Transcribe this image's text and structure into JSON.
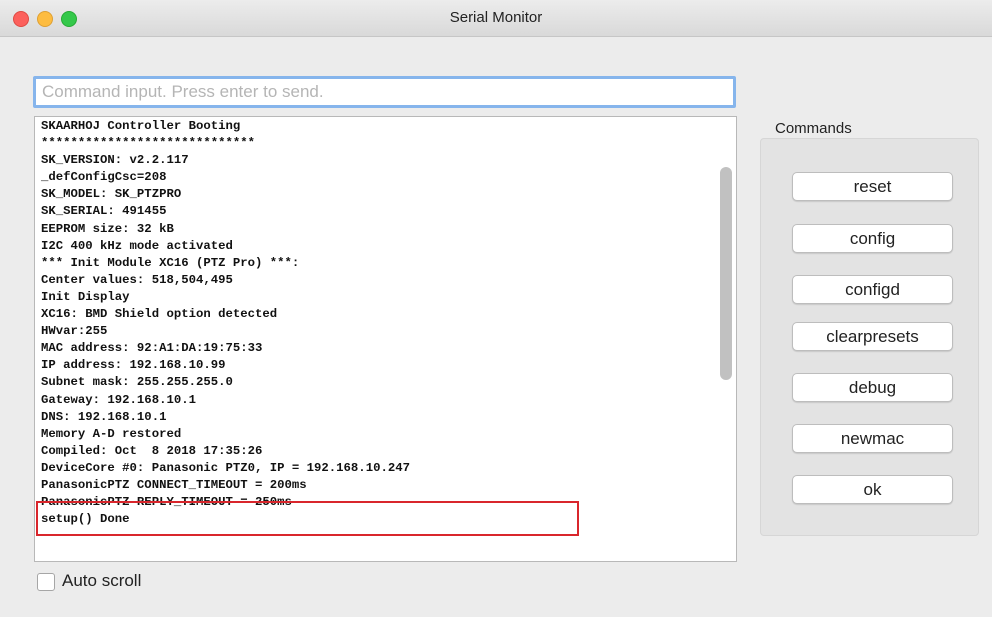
{
  "window": {
    "title": "Serial Monitor"
  },
  "command_input": {
    "placeholder": "Command input. Press enter to send.",
    "value": ""
  },
  "log": {
    "lines": [
      "SKAARHOJ Controller Booting",
      "*****************************",
      "SK_VERSION: v2.2.117",
      "_defConfigCsc=208",
      "SK_MODEL: SK_PTZPRO",
      "SK_SERIAL: 491455",
      "EEPROM size: 32 kB",
      "I2C 400 kHz mode activated",
      "*** Init Module XC16 (PTZ Pro) ***:",
      "Center values: 518,504,495",
      "Init Display",
      "XC16: BMD Shield option detected",
      "HWvar:255",
      "MAC address: 92:A1:DA:19:75:33",
      "IP address: 192.168.10.99",
      "Subnet mask: 255.255.255.0",
      "Gateway: 192.168.10.1",
      "DNS: 192.168.10.1",
      "Memory A-D restored",
      "Compiled: Oct  8 2018 17:35:26",
      "DeviceCore #0: Panasonic PTZ0, IP = 192.168.10.247",
      "PanasonicPTZ CONNECT_TIMEOUT = 200ms",
      "PanasonicPTZ REPLY_TIMEOUT = 250ms",
      "setup() Done"
    ]
  },
  "auto_scroll": {
    "label": "Auto scroll",
    "checked": false
  },
  "commands": {
    "title": "Commands",
    "buttons": [
      "reset",
      "config",
      "configd",
      "clearpresets",
      "debug",
      "newmac",
      "ok"
    ]
  },
  "colors": {
    "highlight": "#d9262c",
    "focus_ring": "#86b5ec"
  }
}
